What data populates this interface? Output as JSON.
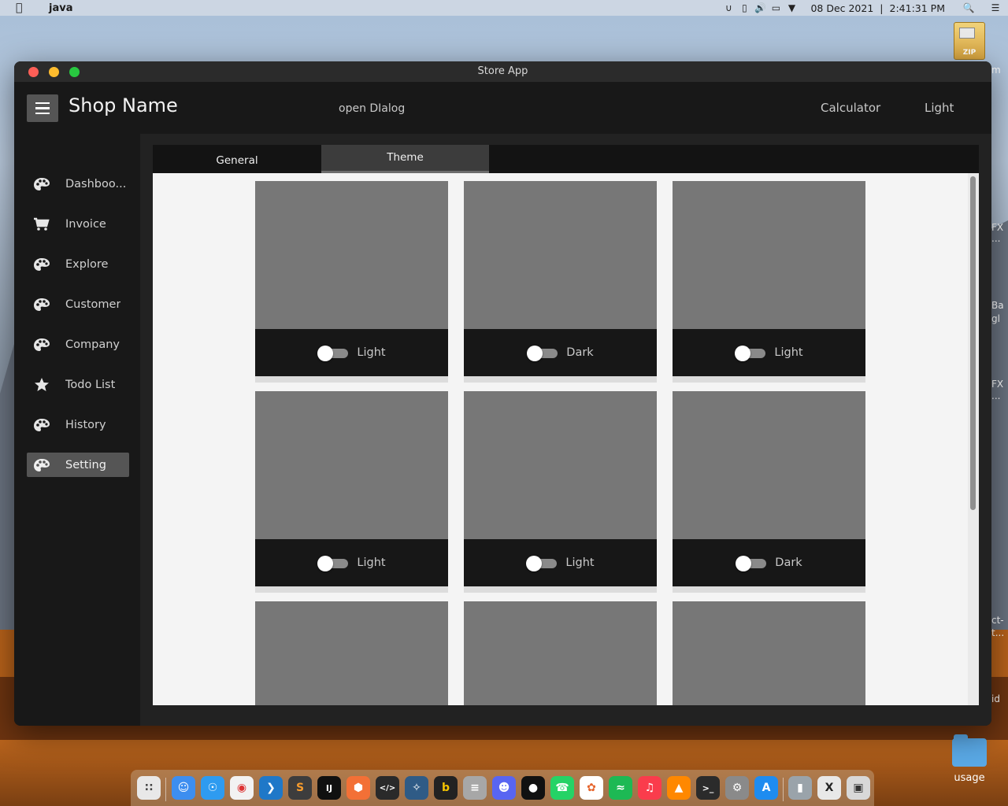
{
  "menubar": {
    "app_name": "java",
    "date": "08 Dec 2021",
    "separator": "|",
    "time": "2:41:31 PM"
  },
  "desktop": {
    "zip_label": "ZIP",
    "folder_label": "usage",
    "side_texts": [
      "m",
      "FX",
      "...",
      "Ba",
      "gl",
      "FX",
      "...",
      "ct-",
      "t...",
      "id"
    ]
  },
  "window": {
    "title": "Store App"
  },
  "appbar": {
    "shop_name": "Shop Name",
    "open_dialog": "open DIalog",
    "calculator": "Calculator",
    "theme_toggle": "Light"
  },
  "sidebar": {
    "items": [
      {
        "label": "Dashboo...",
        "icon": "palette-icon"
      },
      {
        "label": "Invoice",
        "icon": "cart-icon"
      },
      {
        "label": "Explore",
        "icon": "palette-icon"
      },
      {
        "label": "Customer",
        "icon": "palette-icon"
      },
      {
        "label": "Company",
        "icon": "palette-icon"
      },
      {
        "label": "Todo List",
        "icon": "star-icon"
      },
      {
        "label": "History",
        "icon": "palette-icon"
      },
      {
        "label": "Setting",
        "icon": "palette-icon"
      }
    ],
    "active_index": 7
  },
  "tabs": {
    "general": "General",
    "theme": "Theme",
    "active": "Theme"
  },
  "themes": [
    {
      "label": "Light",
      "on": false
    },
    {
      "label": "Dark",
      "on": false
    },
    {
      "label": "Light",
      "on": false
    },
    {
      "label": "Light",
      "on": false
    },
    {
      "label": "Light",
      "on": false
    },
    {
      "label": "Dark",
      "on": false
    },
    {
      "label": "",
      "on": false
    },
    {
      "label": "",
      "on": false
    },
    {
      "label": "",
      "on": false
    }
  ],
  "colors": {
    "window_bg": "#1b1b1b",
    "card_preview": "#777777",
    "card_footer": "#171717",
    "active_nav": "#555555",
    "content_bg": "#f4f4f4"
  },
  "dock": {
    "apps": [
      "launchpad-icon",
      "finder-icon",
      "safari-icon",
      "chrome-icon",
      "vscode-icon",
      "sublime-icon",
      "intellij-icon",
      "postman-icon",
      "scripteditor-icon",
      "mysql-workbench-icon",
      "bing-icon",
      "database-icon",
      "discord-icon",
      "github-icon",
      "whatsapp-icon",
      "photos-icon",
      "spotify-icon",
      "music-icon",
      "vlc-icon",
      "terminal-icon",
      "system-preferences-icon",
      "appstore-icon",
      "trash-icon",
      "xquartz-icon",
      "screenshot-icon"
    ]
  }
}
